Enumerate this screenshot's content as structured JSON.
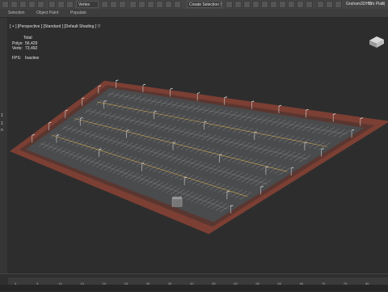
{
  "toolbar": {
    "selection_filter": "Vertex",
    "selection_set": "Create Selection Se",
    "user": "Graham3DHD",
    "workspace": "Wo Plan",
    "workspace_value": "2("
  },
  "ribbon": {
    "tabs": [
      "Selection",
      "Object Paint",
      "Populate"
    ]
  },
  "viewport": {
    "label": "[ + ] [Perspective ] [Standard ] [Default Shading ]",
    "filter_icon": "funnel-icon"
  },
  "stats": {
    "header": "Total",
    "polys_label": "Polys:",
    "polys_value": "56,429",
    "verts_label": "Verts:",
    "verts_value": "73,492",
    "fps_label": "FPS:",
    "fps_value": "Inactive"
  },
  "left_panel": {
    "glyphs": [
      "1",
      "1",
      "n"
    ]
  },
  "timeline": {
    "ticks": [
      "0",
      "5",
      "10",
      "15",
      "20",
      "25",
      "30",
      "35",
      "40",
      "45",
      "50",
      "55",
      "60",
      "65",
      "70",
      "75",
      "80"
    ]
  },
  "colors": {
    "background": "#2b2b2b",
    "lot_surface": "#4a4b4d",
    "curb": "#7c3f33",
    "parking_line": "#d9d9d9",
    "accent_line": "#c9a24a"
  }
}
